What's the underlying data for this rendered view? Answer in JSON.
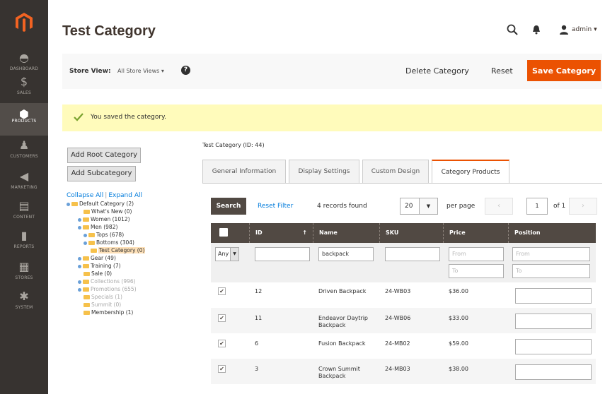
{
  "sidebar": {
    "items": [
      {
        "label": "DASHBOARD",
        "icon": "dashboard-icon"
      },
      {
        "label": "SALES",
        "icon": "dollar-icon"
      },
      {
        "label": "PRODUCTS",
        "icon": "cube-icon"
      },
      {
        "label": "CUSTOMERS",
        "icon": "person-icon"
      },
      {
        "label": "MARKETING",
        "icon": "megaphone-icon"
      },
      {
        "label": "CONTENT",
        "icon": "layout-icon"
      },
      {
        "label": "REPORTS",
        "icon": "bar-chart-icon"
      },
      {
        "label": "STORES",
        "icon": "store-icon"
      },
      {
        "label": "SYSTEM",
        "icon": "gear-icon"
      }
    ],
    "active": "PRODUCTS"
  },
  "header": {
    "title": "Test Category",
    "user": "admin"
  },
  "actions": {
    "store_view_label": "Store View:",
    "store_view_value": "All Store Views",
    "help": "?",
    "delete": "Delete Category",
    "reset": "Reset",
    "save": "Save Category"
  },
  "message": "You saved the category.",
  "tree": {
    "add_root": "Add Root Category",
    "add_sub": "Add Subcategory",
    "collapse": "Collapse All",
    "separator": "|",
    "expand": "Expand All",
    "nodes": [
      "Default Category (2)",
      "What's New (0)",
      "Women (1012)",
      "Men (982)",
      "Tops (678)",
      "Bottoms (304)",
      "Test Category (0)",
      "Gear (49)",
      "Training (7)",
      "Sale (0)",
      "Collections (996)",
      "Promotions (655)",
      "Specials (1)",
      "Summit (0)",
      "Membership (1)"
    ]
  },
  "content": {
    "crumb": "Test Category (ID: 44)",
    "tabs": [
      "General Information",
      "Display Settings",
      "Custom Design",
      "Category Products"
    ],
    "active_tab": "Category Products"
  },
  "grid": {
    "search": "Search",
    "reset_filter": "Reset Filter",
    "records": "4 records found",
    "per_page_value": "20",
    "per_page_label": "per page",
    "page": "1",
    "of": "of 1",
    "columns": [
      "ID",
      "Name",
      "SKU",
      "Price",
      "Position"
    ],
    "sort_mark": "↑",
    "filter": {
      "any": "Any",
      "name": "backpack",
      "from": "From",
      "to": "To"
    },
    "rows": [
      {
        "id": "12",
        "name": [
          "Driven Backpack"
        ],
        "sku": "24-WB03",
        "price": "$36.00"
      },
      {
        "id": "11",
        "name": [
          "Endeavor Daytrip",
          "Backpack"
        ],
        "sku": "24-WB06",
        "price": "$33.00"
      },
      {
        "id": "6",
        "name": [
          "Fusion Backpack"
        ],
        "sku": "24-MB02",
        "price": "$59.00"
      },
      {
        "id": "3",
        "name": [
          "Crown Summit",
          "Backpack"
        ],
        "sku": "24-MB03",
        "price": "$38.00"
      }
    ]
  },
  "colors": {
    "sidebar": "#373330",
    "accent": "#eb5202",
    "link": "#007bdb",
    "table_header": "#514943",
    "message_bg": "#fffbbb"
  }
}
